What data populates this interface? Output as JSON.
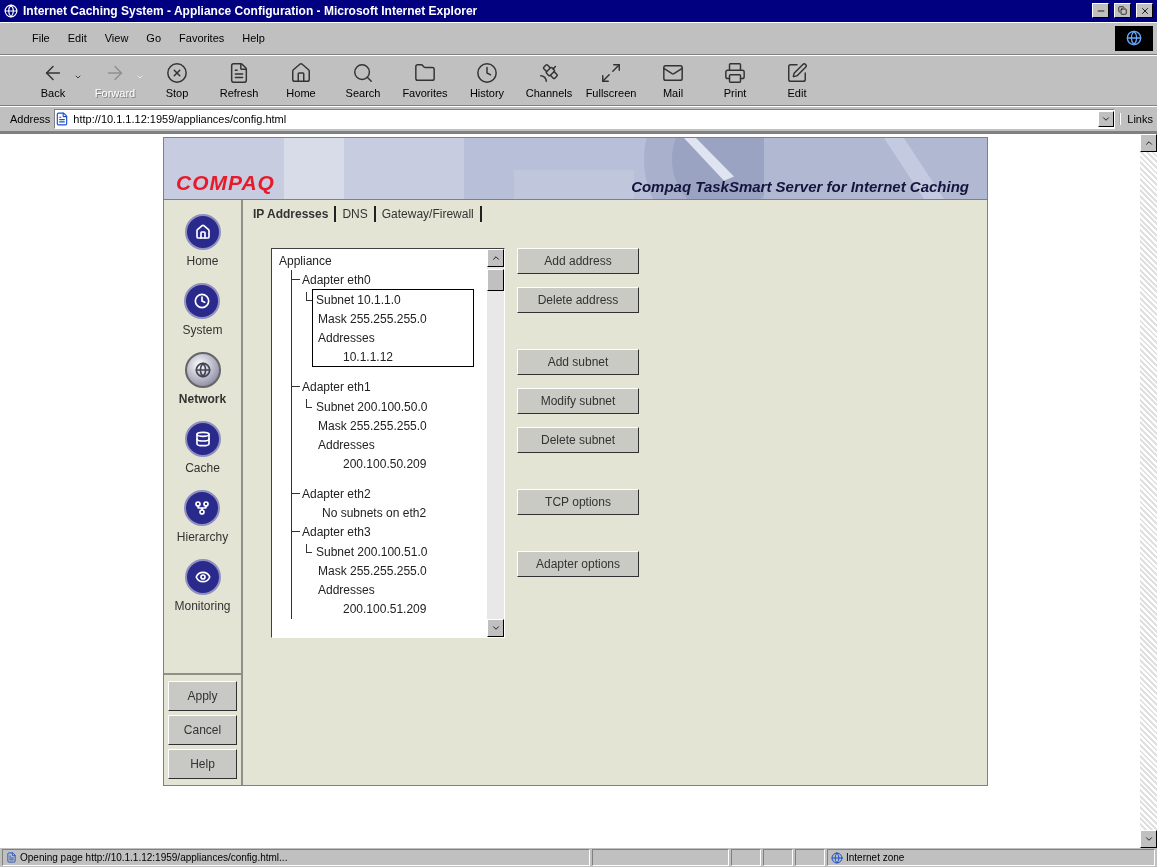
{
  "window": {
    "title": "Internet Caching System - Appliance Configuration - Microsoft Internet Explorer"
  },
  "menu": [
    "File",
    "Edit",
    "View",
    "Go",
    "Favorites",
    "Help"
  ],
  "toolbar": [
    {
      "label": "Back",
      "disabled": false,
      "dropdown": true
    },
    {
      "label": "Forward",
      "disabled": true,
      "dropdown": true
    },
    {
      "label": "Stop",
      "disabled": false,
      "dropdown": false
    },
    {
      "label": "Refresh",
      "disabled": false,
      "dropdown": false
    },
    {
      "label": "Home",
      "disabled": false,
      "dropdown": false
    },
    {
      "label": "Search",
      "disabled": false,
      "dropdown": false
    },
    {
      "label": "Favorites",
      "disabled": false,
      "dropdown": false
    },
    {
      "label": "History",
      "disabled": false,
      "dropdown": false
    },
    {
      "label": "Channels",
      "disabled": false,
      "dropdown": false
    },
    {
      "label": "Fullscreen",
      "disabled": false,
      "dropdown": false
    },
    {
      "label": "Mail",
      "disabled": false,
      "dropdown": false
    },
    {
      "label": "Print",
      "disabled": false,
      "dropdown": false
    },
    {
      "label": "Edit",
      "disabled": false,
      "dropdown": false
    }
  ],
  "address_bar": {
    "label": "Address",
    "url": "http://10.1.1.12:1959/appliances/config.html",
    "links": "Links"
  },
  "page": {
    "brand": "COMPAQ",
    "product": "Compaq TaskSmart Server for Internet Caching",
    "nav": [
      {
        "label": "Home",
        "selected": false
      },
      {
        "label": "System",
        "selected": false
      },
      {
        "label": "Network",
        "selected": true
      },
      {
        "label": "Cache",
        "selected": false
      },
      {
        "label": "Hierarchy",
        "selected": false
      },
      {
        "label": "Monitoring",
        "selected": false
      }
    ],
    "actions": [
      "Apply",
      "Cancel",
      "Help"
    ],
    "tabs": [
      {
        "label": "IP Addresses",
        "selected": true
      },
      {
        "label": "DNS",
        "selected": false
      },
      {
        "label": "Gateway/Firewall",
        "selected": false
      }
    ],
    "tree": {
      "label": "Appliance",
      "children": [
        {
          "label": "Adapter eth0",
          "children": [
            {
              "kind": "subnet",
              "label": "Subnet 10.1.1.0",
              "selected": true,
              "mask": "Mask 255.255.255.0",
              "addresses_label": "Addresses",
              "addresses": [
                "10.1.1.12"
              ]
            }
          ]
        },
        {
          "label": "Adapter eth1",
          "children": [
            {
              "kind": "subnet",
              "label": "Subnet 200.100.50.0",
              "selected": false,
              "mask": "Mask 255.255.255.0",
              "addresses_label": "Addresses",
              "addresses": [
                "200.100.50.209"
              ]
            }
          ]
        },
        {
          "label": "Adapter eth2",
          "children": [
            {
              "kind": "note",
              "label": "No subnets on eth2"
            }
          ]
        },
        {
          "label": "Adapter eth3",
          "children": [
            {
              "kind": "subnet",
              "label": "Subnet 200.100.51.0",
              "selected": false,
              "mask": "Mask 255.255.255.0",
              "addresses_label": "Addresses",
              "addresses": [
                "200.100.51.209"
              ]
            }
          ]
        }
      ]
    },
    "button_groups": [
      [
        "Add address",
        "Delete address"
      ],
      [
        "Add subnet",
        "Modify subnet",
        "Delete subnet"
      ],
      [
        "TCP options"
      ],
      [
        "Adapter options"
      ]
    ]
  },
  "status_bar": {
    "message": "Opening page http://10.1.1.12:1959/appliances/config.html...",
    "zone": "Internet zone"
  }
}
